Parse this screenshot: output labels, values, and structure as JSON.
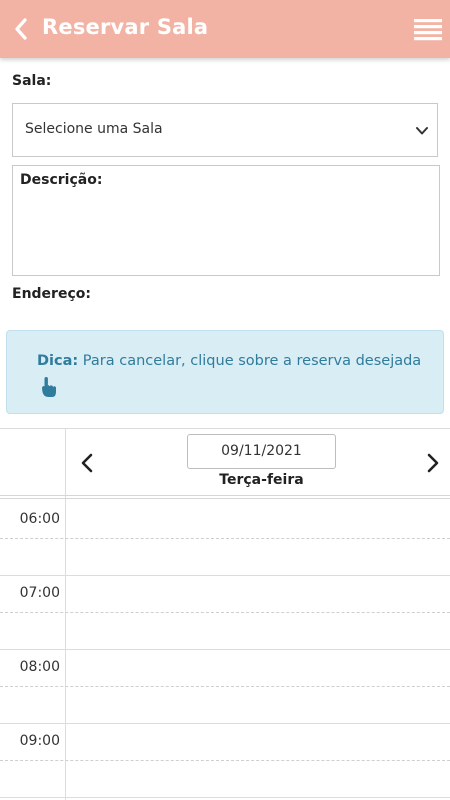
{
  "header": {
    "title": "Reservar Sala",
    "back_icon": "chevron-left-icon",
    "menu_icon": "hamburger-menu-icon",
    "background_color": "#f2b3a5"
  },
  "form": {
    "room_label": "Sala:",
    "room_select_value": "Selecione uma Sala",
    "description_label": "Descrição:",
    "address_label": "Endereço:"
  },
  "tip": {
    "label": "Dica:",
    "text": "Para cancelar, clique sobre a reserva desejada",
    "icon": "hand-pointer-icon",
    "text_color": "#2f7c9d",
    "background_color": "#d9edf5"
  },
  "calendar": {
    "date_value": "09/11/2021",
    "weekday": "Terça-feira",
    "prev_icon": "chevron-left-icon",
    "next_icon": "chevron-right-icon",
    "hours": [
      "06:00",
      "07:00",
      "08:00",
      "09:00"
    ]
  }
}
